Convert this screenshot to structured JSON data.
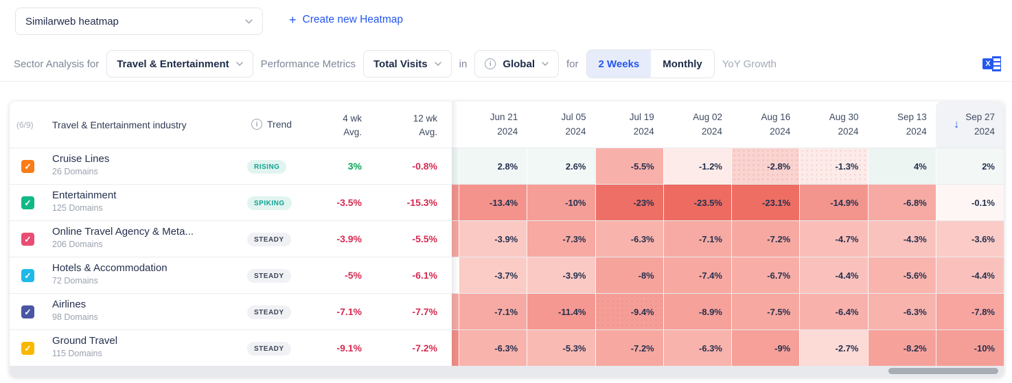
{
  "icons": {
    "plus": "+",
    "check": "✓",
    "info": "i",
    "sort_desc": "↓",
    "excel_x": "X"
  },
  "topbar": {
    "heatmap_selector_value": "Similarweb heatmap",
    "create_button_label": "Create new Heatmap"
  },
  "toolbar": {
    "sector_label": "Sector Analysis for",
    "sector_value": "Travel & Entertainment",
    "metrics_label": "Performance Metrics",
    "metrics_value": "Total Visits",
    "in_label": "in",
    "region_value": "Global",
    "for_label": "for",
    "toggle": {
      "two_weeks": "2 Weeks",
      "monthly": "Monthly",
      "selected": "2 Weeks"
    },
    "yoy_label": "YoY Growth"
  },
  "table": {
    "counter": "(6/9)",
    "industry_header": "Travel & Entertainment industry",
    "trend_header": "Trend",
    "avg4_header_l1": "4 wk",
    "avg4_header_l2": "Avg.",
    "avg12_header_l1": "12 wk",
    "avg12_header_l2": "Avg.",
    "sorted_column": "Sep 27 2024",
    "dates": [
      {
        "l1": "Jun 21",
        "l2": "2024"
      },
      {
        "l1": "Jul 05",
        "l2": "2024"
      },
      {
        "l1": "Jul 19",
        "l2": "2024"
      },
      {
        "l1": "Aug 02",
        "l2": "2024"
      },
      {
        "l1": "Aug 16",
        "l2": "2024"
      },
      {
        "l1": "Aug 30",
        "l2": "2024"
      },
      {
        "l1": "Sep 13",
        "l2": "2024"
      },
      {
        "l1": "Sep 27",
        "l2": "2024"
      }
    ],
    "rows": [
      {
        "name": "Cruise Lines",
        "domains": "26 Domains",
        "checkbox_color": "#f97c17",
        "trend": "RISING",
        "trend_color": "#0ea390",
        "trend_bg": "#e1f4f0",
        "avg4": "3%",
        "avg4_color": "#0ba155",
        "avg12": "-0.8%",
        "avg12_color": "#d5294f",
        "sliver_bg": "#edf5f3",
        "cells": [
          {
            "v": "2.8%",
            "bg": "#f0f7f5"
          },
          {
            "v": "2.6%",
            "bg": "#f1f8f6"
          },
          {
            "v": "-5.5%",
            "bg": "#f8b0aa"
          },
          {
            "v": "-1.2%",
            "bg": "#fdebea"
          },
          {
            "v": "-2.8%",
            "bg": "radial-gradient(rgba(222,92,82,0.28) 1px, rgba(255,255,255,0) 1.2px) 0 0 / 7px 7px, #f9d4d0"
          },
          {
            "v": "-1.3%",
            "bg": "radial-gradient(rgba(222,92,82,0.22) 1px, rgba(255,255,255,0) 1.2px) 0 0 / 7px 7px, #fcebe9"
          },
          {
            "v": "4%",
            "bg": "#edf5f3"
          },
          {
            "v": "2%",
            "bg": "#f3f8f7"
          }
        ]
      },
      {
        "name": "Entertainment",
        "domains": "125 Domains",
        "checkbox_color": "#12b886",
        "trend": "SPIKING",
        "trend_color": "#0ea390",
        "trend_bg": "#e1f4f0",
        "avg4": "-3.5%",
        "avg4_color": "#d5294f",
        "avg12": "-15.3%",
        "avg12_color": "#d5294f",
        "sliver_bg": "#f2928b",
        "cells": [
          {
            "v": "-13.4%",
            "bg": "#f4938c"
          },
          {
            "v": "-10%",
            "bg": "#f59e97"
          },
          {
            "v": "-23%",
            "bg": "#ee6f65"
          },
          {
            "v": "-23.5%",
            "bg": "#ed6b61"
          },
          {
            "v": "-23.1%",
            "bg": "#ee6e64"
          },
          {
            "v": "-14.9%",
            "bg": "#f3958d"
          },
          {
            "v": "-6.8%",
            "bg": "#f6aaa3"
          },
          {
            "v": "-0.1%",
            "bg": "#fdf6f5"
          }
        ]
      },
      {
        "name": "Online Travel Agency & Meta...",
        "domains": "206 Domains",
        "checkbox_color": "#e94d73",
        "trend": "STEADY",
        "trend_color": "#3b4457",
        "trend_bg": "#f0f1f4",
        "avg4": "-3.9%",
        "avg4_color": "#d5294f",
        "avg12": "-5.5%",
        "avg12_color": "#d5294f",
        "sliver_bg": "#f6a59e",
        "cells": [
          {
            "v": "-3.9%",
            "bg": "#fbc9c4"
          },
          {
            "v": "-7.3%",
            "bg": "#f7a9a2"
          },
          {
            "v": "-6.3%",
            "bg": "#f8b3ac"
          },
          {
            "v": "-7.1%",
            "bg": "#f7aaa3"
          },
          {
            "v": "-7.2%",
            "bg": "#f7a9a1"
          },
          {
            "v": "-4.7%",
            "bg": "#fabdb8"
          },
          {
            "v": "-4.3%",
            "bg": "#fac2bd"
          },
          {
            "v": "-3.6%",
            "bg": "#fbccc7"
          }
        ]
      },
      {
        "name": "Hotels & Accommodation",
        "domains": "72 Domains",
        "checkbox_color": "#1fb9e9",
        "trend": "STEADY",
        "trend_color": "#3b4457",
        "trend_bg": "#f0f1f4",
        "avg4": "-5%",
        "avg4_color": "#d5294f",
        "avg12": "-6.1%",
        "avg12_color": "#d5294f",
        "sliver_bg": "#fefdfd",
        "cells": [
          {
            "v": "-3.7%",
            "bg": "#fbcbc6"
          },
          {
            "v": "-3.9%",
            "bg": "#fbc9c4"
          },
          {
            "v": "-8%",
            "bg": "#f6a39c"
          },
          {
            "v": "-7.4%",
            "bg": "#f7a8a1"
          },
          {
            "v": "-6.7%",
            "bg": "#f8aea7"
          },
          {
            "v": "-4.4%",
            "bg": "#fac1bc"
          },
          {
            "v": "-5.6%",
            "bg": "#f9b4ae"
          },
          {
            "v": "-4.4%",
            "bg": "#fac1bc"
          }
        ]
      },
      {
        "name": "Airlines",
        "domains": "98 Domains",
        "checkbox_color": "#4a56a4",
        "trend": "STEADY",
        "trend_color": "#3b4457",
        "trend_bg": "#f0f1f4",
        "avg4": "-7.1%",
        "avg4_color": "#d5294f",
        "avg12": "-7.7%",
        "avg12_color": "#d5294f",
        "sliver_bg": "#f7a8a1",
        "cells": [
          {
            "v": "-7.1%",
            "bg": "#f7aaa3"
          },
          {
            "v": "-11.4%",
            "bg": "#f59891"
          },
          {
            "v": "-9.4%",
            "bg": "radial-gradient(rgba(222,92,82,0.25) 1px, rgba(255,255,255,0) 1.2px) 0 0 / 7px 7px, #f59e97"
          },
          {
            "v": "-8.9%",
            "bg": "#f6a19a"
          },
          {
            "v": "-7.5%",
            "bg": "#f7a8a0"
          },
          {
            "v": "-6.4%",
            "bg": "#f8b1ab"
          },
          {
            "v": "-6.3%",
            "bg": "#f8b3ac"
          },
          {
            "v": "-7.8%",
            "bg": "#f7a59e"
          }
        ]
      },
      {
        "name": "Ground Travel",
        "domains": "115 Domains",
        "checkbox_color": "#f9b800",
        "trend": "STEADY",
        "trend_color": "#3b4457",
        "trend_bg": "#f0f1f4",
        "avg4": "-9.1%",
        "avg4_color": "#d5294f",
        "avg12": "-7.2%",
        "avg12_color": "#d5294f",
        "sliver_bg": "#f28d85",
        "cells": [
          {
            "v": "-6.3%",
            "bg": "#f8b3ac"
          },
          {
            "v": "-5.3%",
            "bg": "#f9bab4"
          },
          {
            "v": "-7.2%",
            "bg": "#f7a9a1"
          },
          {
            "v": "-6.3%",
            "bg": "#f8b3ac"
          },
          {
            "v": "-9%",
            "bg": "#f6a099"
          },
          {
            "v": "-2.7%",
            "bg": "#fcdad6"
          },
          {
            "v": "-8.2%",
            "bg": "#f6a29b"
          },
          {
            "v": "-10%",
            "bg": "#f59e97"
          }
        ]
      }
    ]
  }
}
